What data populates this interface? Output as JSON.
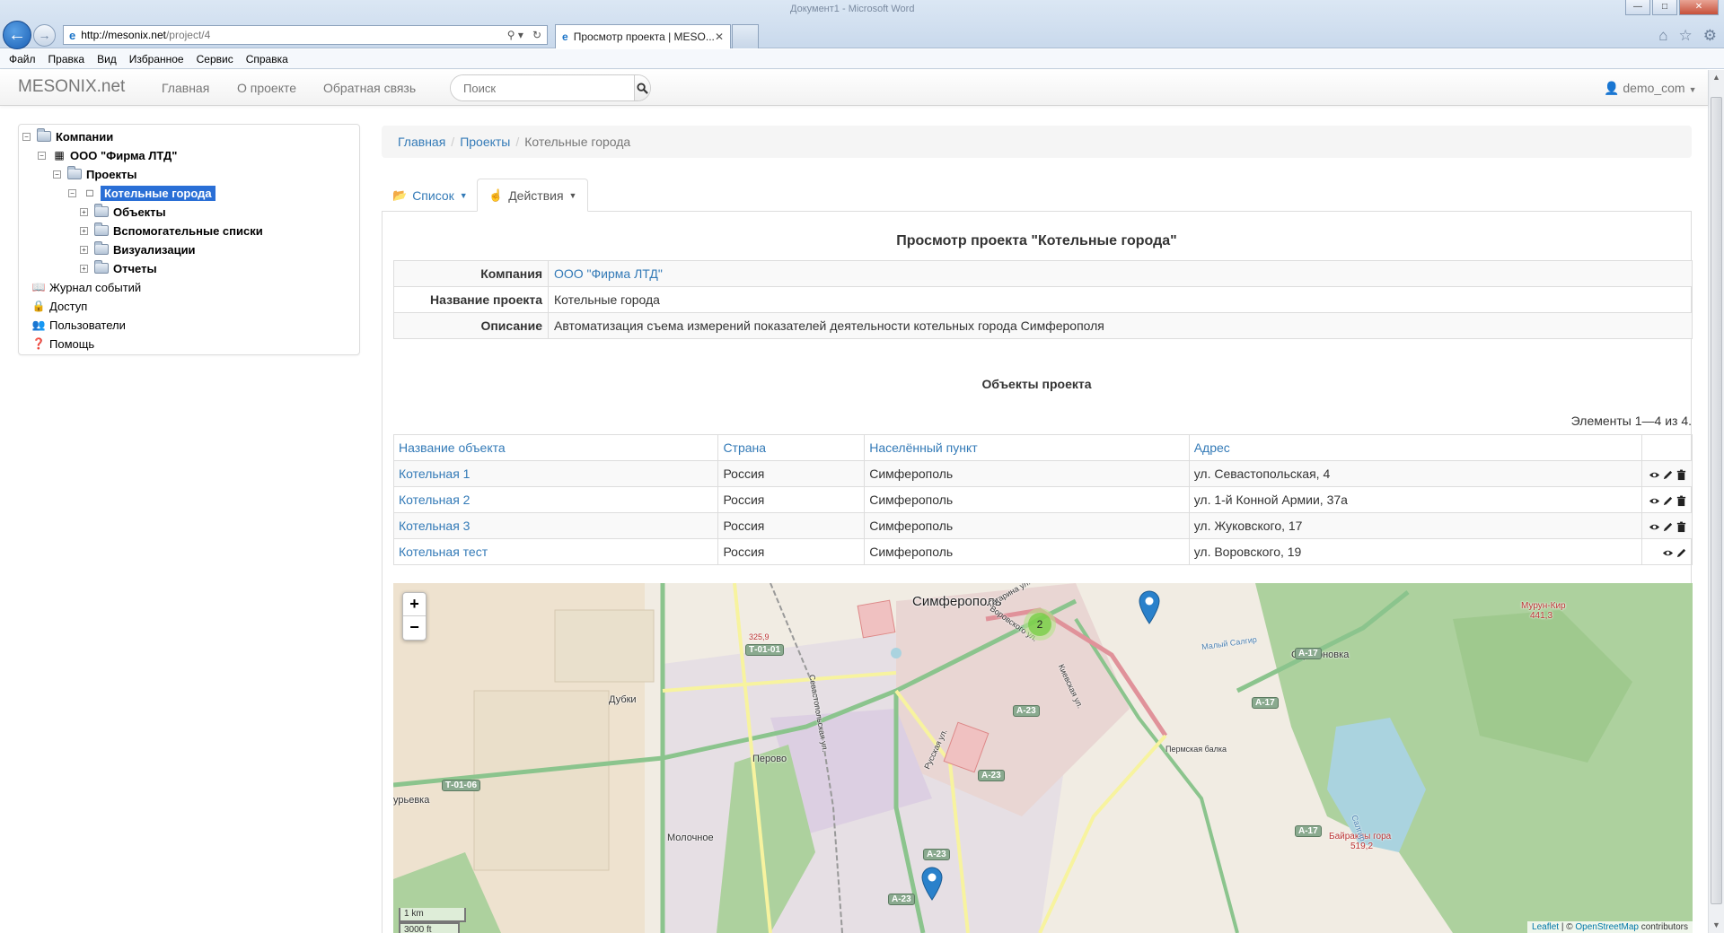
{
  "browser": {
    "window_title": "Документ1 - Microsoft Word",
    "address": {
      "host": "http://mesonix.net",
      "path": "/project/4"
    },
    "tab_title": "Просмотр проекта | MESO...",
    "menu": [
      "Файл",
      "Правка",
      "Вид",
      "Избранное",
      "Сервис",
      "Справка"
    ]
  },
  "navbar": {
    "brand": "MESONIX.net",
    "links": [
      "Главная",
      "О проекте",
      "Обратная связь"
    ],
    "search_placeholder": "Поиск",
    "user": "demo_com"
  },
  "tree": {
    "root": "Компании",
    "company": "ООО \"Фирма ЛТД\"",
    "projects": "Проекты",
    "selected_project": "Котельные города",
    "project_children": [
      "Объекты",
      "Вспомогательные списки",
      "Визуализации",
      "Отчеты"
    ],
    "tools": [
      "Журнал событий",
      "Доступ",
      "Пользователи",
      "Помощь"
    ]
  },
  "breadcrumb": {
    "home": "Главная",
    "projects": "Проекты",
    "current": "Котельные города"
  },
  "tabs": {
    "list": "Список",
    "actions": "Действия"
  },
  "project": {
    "title": "Просмотр проекта \"Котельные города\"",
    "fields": [
      {
        "key": "Компания",
        "value": "ООО \"Фирма ЛТД\""
      },
      {
        "key": "Название проекта",
        "value": "Котельные города"
      },
      {
        "key": "Описание",
        "value": "Автоматизация съема измерений показателей деятельности котельных города Симферополя"
      }
    ]
  },
  "objects": {
    "title": "Объекты проекта",
    "summary": "Элементы 1—4 из 4.",
    "columns": [
      "Название объекта",
      "Страна",
      "Населённый пункт",
      "Адрес"
    ],
    "rows": [
      {
        "name": "Котельная 1",
        "country": "Россия",
        "city": "Симферополь",
        "address": "ул. Севастопольская, 4"
      },
      {
        "name": "Котельная 2",
        "country": "Россия",
        "city": "Симферополь",
        "address": "ул. 1-й Конной Армии, 37а"
      },
      {
        "name": "Котельная 3",
        "country": "Россия",
        "city": "Симферополь",
        "address": "ул. Жуковского, 17"
      },
      {
        "name": "Котельная тест",
        "country": "Россия",
        "city": "Симферополь",
        "address": "ул. Воровского, 19"
      }
    ]
  },
  "map": {
    "zoom_in": "+",
    "zoom_out": "−",
    "scale_km": "1 km",
    "scale_ft": "3000 ft",
    "cluster_count": "2",
    "attribution_leaflet": "Leaflet",
    "attribution_osm": "OpenStreetMap",
    "attribution_rest": "contributors",
    "labels": {
      "city": "Симферополь",
      "dubki": "Дубки",
      "perovo": "Перово",
      "molochnoe": "Молочное",
      "strogonovka": "Строгоновка",
      "ureevka": "урьевка",
      "perm_gully": "Пермская балка",
      "baykara": "Байраклы гора",
      "baykara_h": "519,2",
      "murun": "Мурун-Кир",
      "murun_h": "441,3",
      "h325": "325,9",
      "malyi_salgir": "Малый Салгир",
      "vorovskogo": "Воровского ул.",
      "gagarina": "Гагарина ул.",
      "sevastopolskaya": "Севастопольская ул.",
      "kievskaya": "Киевская ул.",
      "russkaya": "Русская ул.",
      "salgir": "Салгир"
    },
    "roads": {
      "t0101": "Т-01-01",
      "t0106": "Т-01-06",
      "a23": "А-23",
      "a17": "А-17"
    }
  }
}
